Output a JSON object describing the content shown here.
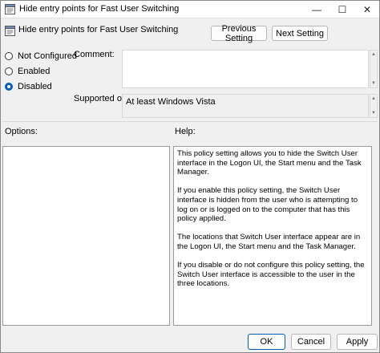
{
  "window": {
    "title": "Hide entry points for Fast User Switching",
    "minimize_glyph": "—",
    "maximize_glyph": "☐",
    "close_glyph": "✕"
  },
  "header": {
    "title": "Hide entry points for Fast User Switching",
    "previous_label": "Previous Setting",
    "next_label": "Next Setting"
  },
  "state_options": [
    {
      "label": "Not Configured",
      "checked": false
    },
    {
      "label": "Enabled",
      "checked": false
    },
    {
      "label": "Disabled",
      "checked": true
    }
  ],
  "comment": {
    "label": "Comment:",
    "value": ""
  },
  "supported": {
    "label": "Supported on:",
    "value": "At least Windows Vista"
  },
  "options": {
    "label": "Options:"
  },
  "help": {
    "label": "Help:",
    "paragraphs": [
      "This policy setting allows you to hide the Switch User interface in the Logon UI, the Start menu and the Task Manager.",
      "If you enable this policy setting, the Switch User interface is hidden from the user who is attempting to log on or is logged on to the computer that has this policy applied.",
      "The locations that Switch User interface appear are in the Logon UI, the Start menu and the Task Manager.",
      "If you disable or do not configure this policy setting, the Switch User interface is accessible to the user in the three locations."
    ]
  },
  "footer": {
    "ok_label": "OK",
    "cancel_label": "Cancel",
    "apply_label": "Apply"
  },
  "colors": {
    "accent": "#005fb8",
    "window_bg": "#f0f0f0",
    "panel_bg": "#ffffff"
  },
  "icons": {
    "window": "policy-settings-icon",
    "header": "policy-settings-icon"
  }
}
